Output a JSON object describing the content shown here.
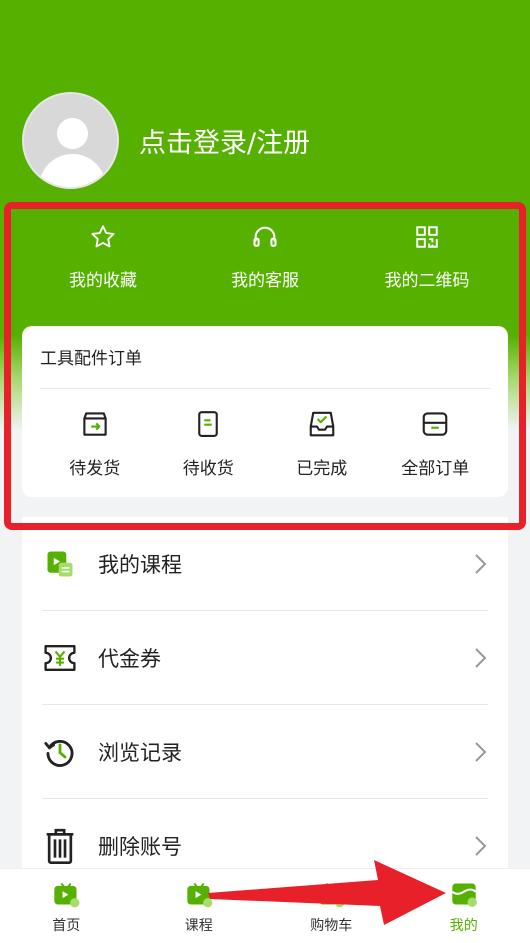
{
  "profile": {
    "login_text": "点击登录/注册"
  },
  "shortcuts": [
    {
      "label": "我的收藏",
      "icon": "star-icon"
    },
    {
      "label": "我的客服",
      "icon": "headset-icon"
    },
    {
      "label": "我的二维码",
      "icon": "qr-code-icon"
    }
  ],
  "orders": {
    "title": "工具配件订单",
    "items": [
      {
        "label": "待发货",
        "icon": "box-arrow-icon"
      },
      {
        "label": "待收货",
        "icon": "receipt-icon"
      },
      {
        "label": "已完成",
        "icon": "inbox-check-icon"
      },
      {
        "label": "全部订单",
        "icon": "card-icon"
      }
    ]
  },
  "menu": [
    {
      "label": "我的课程",
      "icon": "course-icon"
    },
    {
      "label": "代金券",
      "icon": "coupon-icon"
    },
    {
      "label": "浏览记录",
      "icon": "history-icon"
    },
    {
      "label": "删除账号",
      "icon": "trash-icon"
    }
  ],
  "tabbar": {
    "items": [
      {
        "label": "首页",
        "icon": "home-tv-icon",
        "active": false
      },
      {
        "label": "课程",
        "icon": "course-tv-icon",
        "active": false
      },
      {
        "label": "购物车",
        "icon": "cart-icon",
        "active": false
      },
      {
        "label": "我的",
        "icon": "profile-store-icon",
        "active": true
      }
    ]
  },
  "colors": {
    "brand_green": "#55b000",
    "annotation_red": "#e8202a",
    "background": "#f2f3f5"
  }
}
